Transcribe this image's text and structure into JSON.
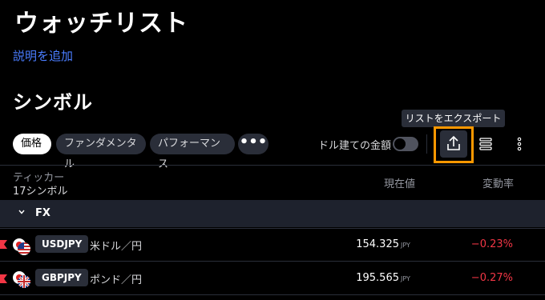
{
  "header": {
    "title": "ウォッチリスト",
    "add_description": "説明を追加",
    "section_title": "シンボル"
  },
  "tabs": [
    {
      "label": "価格",
      "active": true
    },
    {
      "label": "ファンダメンタル",
      "active": false
    },
    {
      "label": "パフォーマンス",
      "active": false
    }
  ],
  "toolbar": {
    "more_label": "•••",
    "tooltip": "リストをエクスポート",
    "toggle_label": "ドル建ての金額",
    "toggle_on": false
  },
  "columns": {
    "ticker": "ティッカー",
    "count": "17シンボル",
    "price": "現在値",
    "change": "変動率"
  },
  "group": {
    "label": "FX"
  },
  "rows": [
    {
      "ticker": "USDJPY",
      "description": "米ドル／円",
      "price": "154.325",
      "unit": "JPY",
      "change": "−0.23%"
    },
    {
      "ticker": "GBPJPY",
      "description": "ポンド／円",
      "price": "195.565",
      "unit": "JPY",
      "change": "−0.27%"
    }
  ],
  "colors": {
    "accent": "#ff9800",
    "link": "#4a7dff",
    "negative": "#f23645",
    "flag_marker": "#f23645"
  },
  "icons": [
    "chevron-down-icon",
    "export-icon",
    "list-layout-icon",
    "more-vertical-icon",
    "flag-marker-icon",
    "us-flag-icon",
    "jp-flag-icon",
    "uk-flag-icon"
  ]
}
